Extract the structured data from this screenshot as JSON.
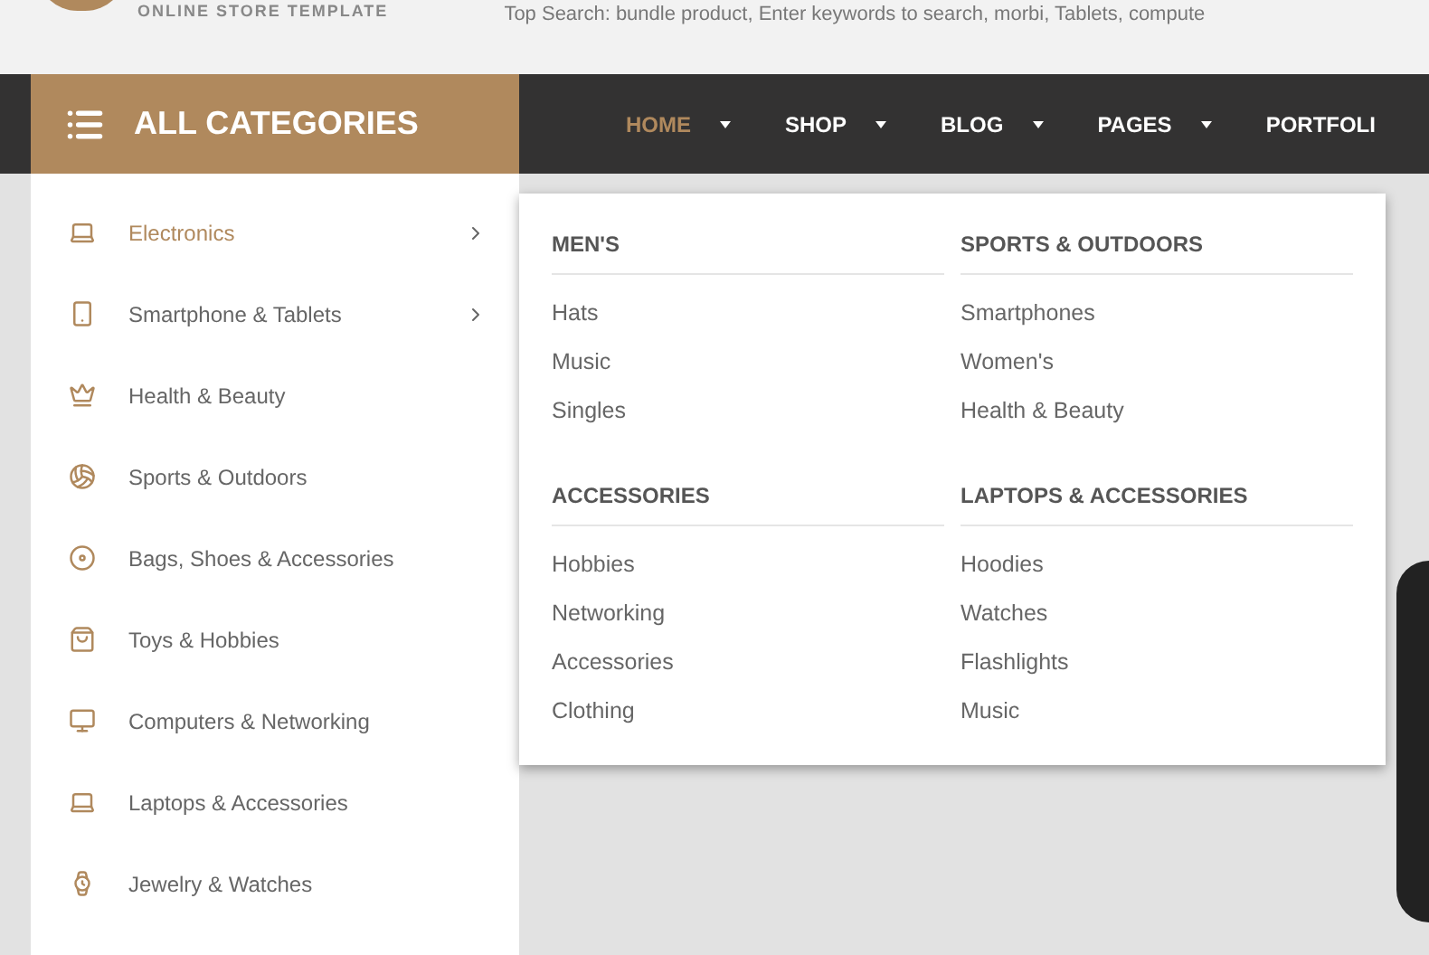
{
  "header": {
    "tagline": "ONLINE STORE TEMPLATE",
    "top_search": "Top Search: bundle product, Enter keywords to search, morbi, Tablets, compute"
  },
  "categories_button": {
    "label": "ALL CATEGORIES"
  },
  "nav": [
    {
      "label": "HOME",
      "selected": true,
      "dropdown": true
    },
    {
      "label": "SHOP",
      "selected": false,
      "dropdown": true
    },
    {
      "label": "BLOG",
      "selected": false,
      "dropdown": true
    },
    {
      "label": "PAGES",
      "selected": false,
      "dropdown": true
    },
    {
      "label": "PORTFOLI",
      "selected": false,
      "dropdown": false
    }
  ],
  "sidebar": {
    "items": [
      {
        "label": "Electronics",
        "kind": "laptop",
        "selected": true,
        "submenu": true
      },
      {
        "label": "Smartphone & Tablets",
        "kind": "phone",
        "selected": false,
        "submenu": true
      },
      {
        "label": "Health & Beauty",
        "kind": "crown",
        "selected": false,
        "submenu": false
      },
      {
        "label": "Sports & Outdoors",
        "kind": "ball",
        "selected": false,
        "submenu": false
      },
      {
        "label": "Bags, Shoes & Accessories",
        "kind": "disc",
        "selected": false,
        "submenu": false
      },
      {
        "label": "Toys & Hobbies",
        "kind": "bag",
        "selected": false,
        "submenu": false
      },
      {
        "label": "Computers & Networking",
        "kind": "monitor",
        "selected": false,
        "submenu": false
      },
      {
        "label": "Laptops & Accessories",
        "kind": "laptop",
        "selected": false,
        "submenu": false
      },
      {
        "label": "Jewelry & Watches",
        "kind": "watch",
        "selected": false,
        "submenu": false
      }
    ]
  },
  "mega_menu": {
    "groups": [
      {
        "title": "MEN'S",
        "links": [
          "Hats",
          "Music",
          "Singles"
        ]
      },
      {
        "title": "SPORTS & OUTDOORS",
        "links": [
          "Smartphones",
          "Women's",
          "Health & Beauty"
        ]
      },
      {
        "title": "ACCESSORIES",
        "links": [
          "Hobbies",
          "Networking",
          "Accessories",
          "Clothing"
        ]
      },
      {
        "title": "LAPTOPS & ACCESSORIES",
        "links": [
          "Hoodies",
          "Watches",
          "Flashlights",
          "Music"
        ]
      }
    ]
  }
}
